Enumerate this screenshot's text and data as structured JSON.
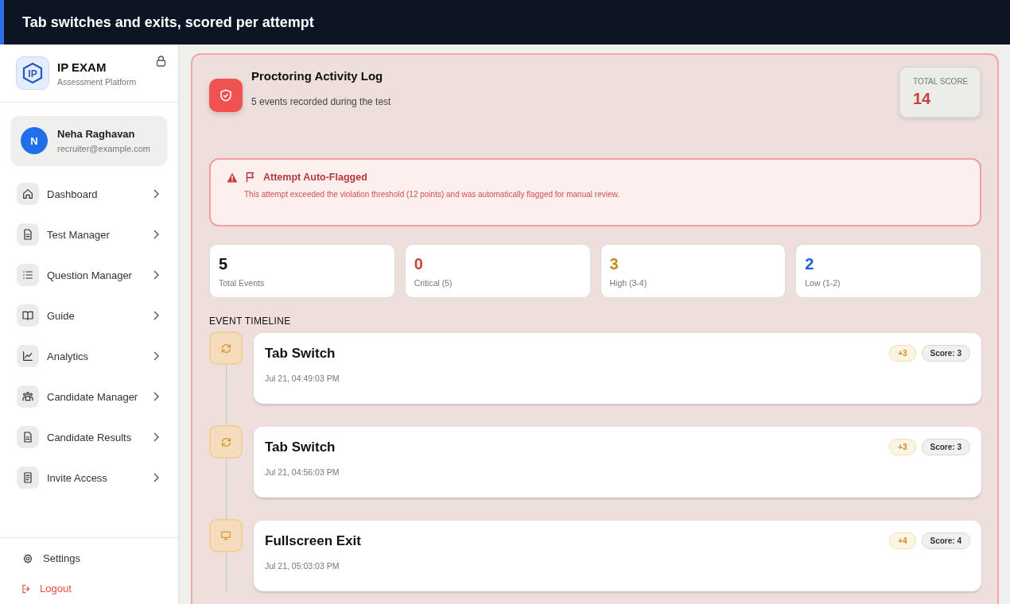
{
  "banner": {
    "title": "Tab switches and exits, scored per attempt"
  },
  "brand": {
    "name": "IP EXAM",
    "tagline": "Assessment Platform",
    "logo": "IP"
  },
  "user": {
    "initial": "N",
    "name": "Neha Raghavan",
    "email": "recruiter@example.com"
  },
  "nav": [
    {
      "label": "Dashboard"
    },
    {
      "label": "Test Manager"
    },
    {
      "label": "Question Manager"
    },
    {
      "label": "Guide"
    },
    {
      "label": "Analytics"
    },
    {
      "label": "Candidate Manager"
    },
    {
      "label": "Candidate Results"
    },
    {
      "label": "Invite Access"
    }
  ],
  "footer": [
    {
      "label": "Settings",
      "kind": "settings"
    },
    {
      "label": "Logout",
      "kind": "logout"
    }
  ],
  "log": {
    "title": "Proctoring Activity Log",
    "subtitle": "5 events recorded during the test",
    "score_label": "TOTAL SCORE",
    "score": "14"
  },
  "alert": {
    "title": "Attempt Auto-Flagged",
    "message": "This attempt exceeded the violation threshold (12 points) and was automatically flagged for manual review."
  },
  "stats": [
    {
      "value": "5",
      "label": "Total Events",
      "color": "#111111"
    },
    {
      "value": "0",
      "label": "Critical (5)",
      "color": "#d14343"
    },
    {
      "value": "3",
      "label": "High (3-4)",
      "color": "#c98a1e"
    },
    {
      "value": "2",
      "label": "Low (1-2)",
      "color": "#1f5eea"
    }
  ],
  "timeline": {
    "heading": "EVENT TIMELINE",
    "events": [
      {
        "kind": "tab_switch",
        "title": "Tab Switch",
        "time": "Jul 21, 04:49:03 PM",
        "points": "+3",
        "score": "Score: 3"
      },
      {
        "kind": "tab_switch",
        "title": "Tab Switch",
        "time": "Jul 21, 04:56:03 PM",
        "points": "+3",
        "score": "Score: 3"
      },
      {
        "kind": "fullscreen_exit",
        "title": "Fullscreen Exit",
        "time": "Jul 21, 05:03:03 PM",
        "points": "+4",
        "score": "Score: 4"
      }
    ]
  }
}
